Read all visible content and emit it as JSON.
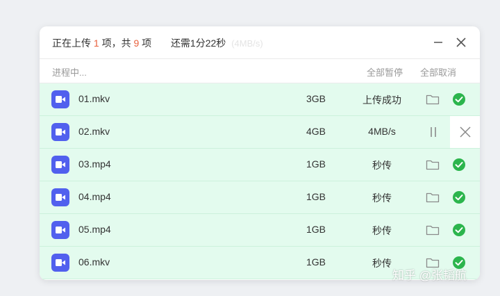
{
  "header": {
    "status_prefix": "正在上传",
    "uploading_count": "1",
    "status_mid": "项，共",
    "total_count": "9",
    "status_suffix": "项",
    "remaining_time": "还需1分22秒",
    "faded_text": "(4MB/s)"
  },
  "subheader": {
    "progress_label": "进程中...",
    "pause_all": "全部暂停",
    "cancel_all": "全部取消"
  },
  "files": [
    {
      "name": "01.mkv",
      "size": "3GB",
      "status": "上传成功",
      "state": "done"
    },
    {
      "name": "02.mkv",
      "size": "4GB",
      "status": "4MB/s",
      "state": "uploading"
    },
    {
      "name": "03.mp4",
      "size": "1GB",
      "status": "秒传",
      "state": "done"
    },
    {
      "name": "04.mp4",
      "size": "1GB",
      "status": "秒传",
      "state": "done"
    },
    {
      "name": "05.mp4",
      "size": "1GB",
      "status": "秒传",
      "state": "done"
    },
    {
      "name": "06.mkv",
      "size": "1GB",
      "status": "秒传",
      "state": "done"
    }
  ],
  "watermark": "知乎 @张韬航",
  "icons": {
    "minimize": "minimize-icon",
    "close": "close-icon",
    "file": "video-file-icon",
    "folder": "folder-icon",
    "check": "success-check-icon",
    "pause": "pause-icon",
    "cancel": "cancel-icon"
  },
  "colors": {
    "accent_number": "#e8603c",
    "row_bg": "#e3fbee",
    "file_icon": "#5160ee",
    "success": "#2cb54d"
  }
}
